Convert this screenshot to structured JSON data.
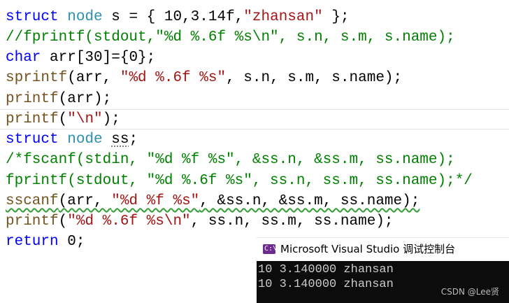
{
  "code": {
    "l1": {
      "kw": "struct",
      "ty": "node",
      "rest1": " s = { 10,3.14f,",
      "str": "\"zhansan\"",
      "rest2": " };"
    },
    "l2": "//fprintf(stdout,\"%d %.6f %s\\n\", s.n, s.m, s.name);",
    "l3": {
      "kw": "char",
      "rest": " arr[30]={0};"
    },
    "l4": {
      "fn": "sprintf",
      "a": "(arr, ",
      "str": "\"%d %.6f %s\"",
      "b": ", s.n, s.m, s.name);"
    },
    "l5": {
      "fn": "printf",
      "rest": "(arr);"
    },
    "l6": {
      "fn": "printf",
      "a": "(",
      "str": "\"\\n\"",
      "b": ");"
    },
    "l7": {
      "kw": "struct",
      "ty": "node",
      "sp": " ",
      "var": "ss",
      "semi": ";"
    },
    "l8": "/*fscanf(stdin, \"%d %f %s\", &ss.n, &ss.m, ss.name);",
    "l9": "fprintf(stdout, \"%d %.6f %s\", ss.n, ss.m, ss.name);*/",
    "l10": {
      "fn": "sscanf",
      "a": "(arr, ",
      "str": "\"%d %f %s\"",
      "b": ", &ss.n, &ss.m, ss.name);"
    },
    "l11": {
      "fn": "printf",
      "a": "(",
      "str": "\"%d %.6f %s\\n\"",
      "b": ", ss.n, ss.m, ss.name);"
    },
    "l12": {
      "kw": "return",
      "rest": " 0;"
    }
  },
  "console": {
    "icon_text": "C:\\",
    "title": "Microsoft Visual Studio 调试控制台",
    "lines": [
      "10 3.140000 zhansan",
      "10 3.140000 zhansan"
    ]
  },
  "watermark": "CSDN @Lee贤",
  "colors": {
    "keyword": "#0000ff",
    "type": "#2b91af",
    "string": "#a31515",
    "comment": "#008000",
    "function": "#74531f",
    "console_bg": "#0c0c0c",
    "console_text": "#cccccc"
  }
}
